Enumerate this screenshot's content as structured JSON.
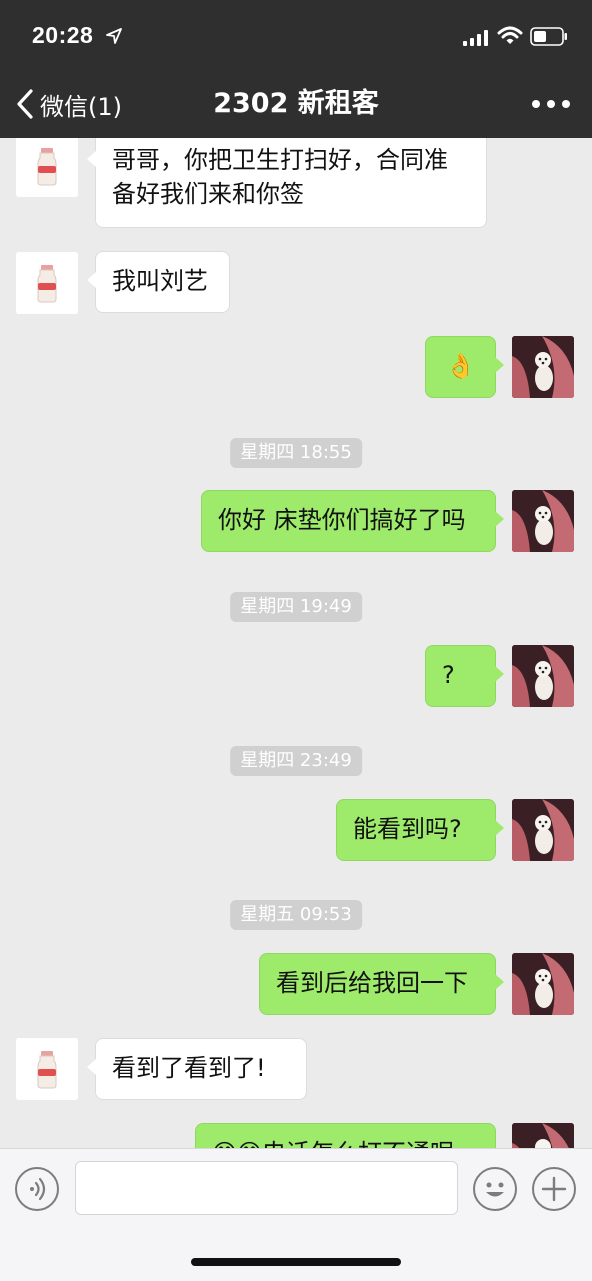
{
  "status_bar": {
    "time": "20:28"
  },
  "nav": {
    "back_label": "微信(1)",
    "title": "2302 新租客"
  },
  "messages": [
    {
      "text": "哥哥，你把卫生打扫好，合同准\n备好我们来和你签"
    },
    {
      "text": "我叫刘艺"
    },
    {
      "text": "👌"
    },
    {
      "time": "星期四 18:55"
    },
    {
      "text": "你好 床垫你们搞好了吗"
    },
    {
      "time": "星期四 19:49"
    },
    {
      "text": "?"
    },
    {
      "time": "星期四 23:49"
    },
    {
      "text": "能看到吗?"
    },
    {
      "time": "星期五 09:53"
    },
    {
      "text": "看到后给我回一下"
    },
    {
      "text": "看到了看到了!"
    },
    {
      "text": "😊😊电话怎么打不通呢"
    }
  ],
  "input": {
    "value": "",
    "placeholder": ""
  },
  "icons": {
    "back": "chevron-left-icon",
    "more": "more-dots-icon",
    "voice": "voice-icon",
    "emoji": "emoji-icon",
    "plus": "plus-icon"
  },
  "colors": {
    "outgoing_bubble": "#9eea6a",
    "incoming_bubble": "#ffffff",
    "header": "#2f2f2f"
  }
}
